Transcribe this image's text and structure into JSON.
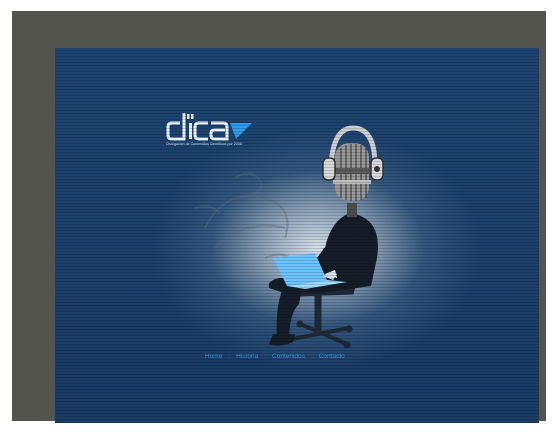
{
  "logo": {
    "text": "dica",
    "tagline": "Divulgación de Contenidos Científicos por 2008"
  },
  "nav": {
    "items": [
      {
        "label": "Home"
      },
      {
        "label": "Historia"
      },
      {
        "label": "Contenidos"
      },
      {
        "label": "Contacto"
      }
    ],
    "separator": ":"
  },
  "colors": {
    "frame": "#54544f",
    "panel": "#1d4370",
    "glow": "#e1e8f0",
    "nav_link": "#3a98de",
    "laptop": "#6cc4ff"
  },
  "icons": {
    "illustration": "microphone-head-person-with-laptop",
    "headphones": "headphones-icon"
  }
}
